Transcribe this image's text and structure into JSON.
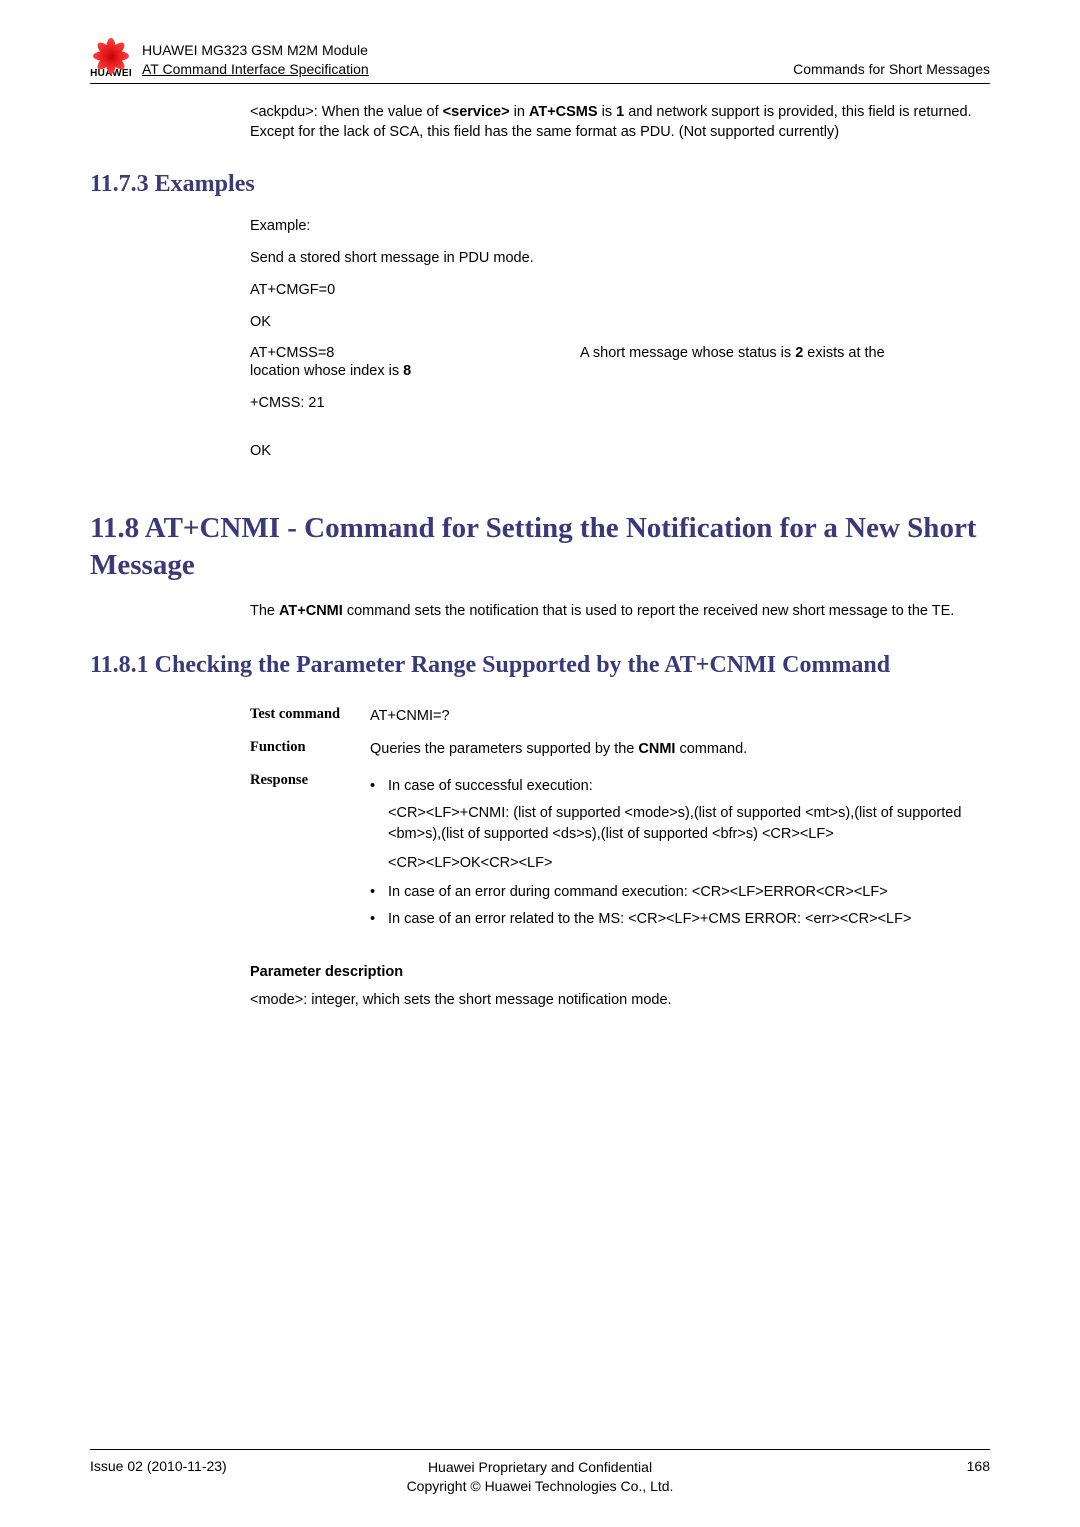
{
  "header": {
    "logo_name": "HUAWEI",
    "product_line": "HUAWEI MG323 GSM M2M Module",
    "spec_line": "AT Command Interface Specification",
    "right": "Commands for Short Messages"
  },
  "top_para": "<ackpdu>: When the value of <service> in AT+CSMS is 1 and network support is provided, this field is returned. Except for the lack of SCA, this field has the same format as PDU. (Not supported currently)",
  "sec1173": {
    "title": "11.7.3 Examples",
    "example_label": "Example:",
    "l1": "Send a stored short message in PDU mode.",
    "l2": "AT+CMGF=0",
    "l3": "OK",
    "l4_left": "AT+CMSS=8",
    "l4_right_a": "A short message whose status is ",
    "l4_right_b": "2",
    "l4_right_c": " exists at the ",
    "l5_left": "location whose index is ",
    "l5_b": "8",
    "l6": "+CMSS: 21",
    "l7": "OK"
  },
  "sec118": {
    "title": "11.8 AT+CNMI - Command for Setting the Notification for a New Short Message",
    "intro_a": "The ",
    "intro_b": "AT+CNMI",
    "intro_c": " command sets the notification that is used to report the received new short message to the TE."
  },
  "sec1181": {
    "title": "11.8.1 Checking the Parameter Range Supported by the AT+CNMI Command",
    "rows": {
      "test_label": "Test command",
      "test_val": "AT+CNMI=?",
      "func_label": "Function",
      "func_val_a": "Queries the parameters supported by the ",
      "func_val_b": "CNMI",
      "func_val_c": " command.",
      "resp_label": "Response",
      "b1": "In case of successful execution:",
      "b1_sub1": "<CR><LF>+CNMI: (list of supported <mode>s),(list of supported <mt>s),(list of supported <bm>s),(list of supported <ds>s),(list of supported <bfr>s) <CR><LF>",
      "b1_sub2": "<CR><LF>OK<CR><LF>",
      "b2": "In case of an error during command execution: <CR><LF>ERROR<CR><LF>",
      "b3": "In case of an error related to the MS: <CR><LF>+CMS ERROR: <err><CR><LF>"
    },
    "param_hdr": "Parameter description",
    "param_body": "<mode>: integer, which sets the short message notification mode."
  },
  "footer": {
    "left": "Issue 02 (2010-11-23)",
    "center1": "Huawei Proprietary and Confidential",
    "center2": "Copyright © Huawei Technologies Co., Ltd.",
    "right": "168"
  }
}
